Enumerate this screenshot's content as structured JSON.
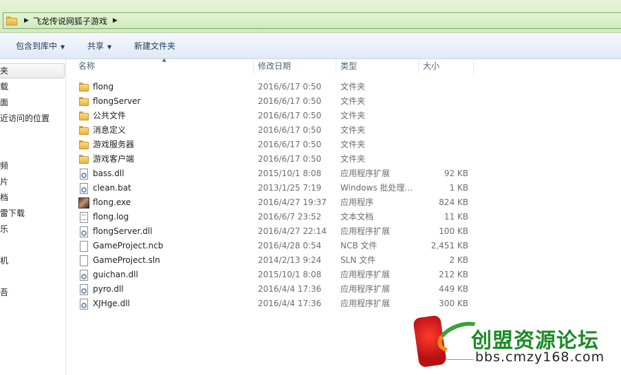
{
  "address_bar": {
    "path": [
      "飞龙传说网狐子游戏"
    ]
  },
  "toolbar": {
    "include_in_library": "包含到库中",
    "share": "共享",
    "new_folder": "新建文件夹"
  },
  "nav": {
    "items": [
      "夹",
      "载",
      "面",
      "近访问的位置",
      "频",
      "片",
      "档",
      "雷下载",
      "乐",
      "机",
      "吾"
    ]
  },
  "columns": {
    "name": "名称",
    "date": "修改日期",
    "type": "类型",
    "size": "大小"
  },
  "files": [
    {
      "name": "flong",
      "date": "2016/6/17 0:50",
      "type": "文件夹",
      "size": "",
      "icon": "folder-icon"
    },
    {
      "name": "flongServer",
      "date": "2016/6/17 0:50",
      "type": "文件夹",
      "size": "",
      "icon": "folder-icon"
    },
    {
      "name": "公共文件",
      "date": "2016/6/17 0:50",
      "type": "文件夹",
      "size": "",
      "icon": "folder-icon"
    },
    {
      "name": "消息定义",
      "date": "2016/6/17 0:50",
      "type": "文件夹",
      "size": "",
      "icon": "folder-icon"
    },
    {
      "name": "游戏服务器",
      "date": "2016/6/17 0:50",
      "type": "文件夹",
      "size": "",
      "icon": "folder-icon"
    },
    {
      "name": "游戏客户端",
      "date": "2016/6/17 0:50",
      "type": "文件夹",
      "size": "",
      "icon": "folder-icon"
    },
    {
      "name": "bass.dll",
      "date": "2015/10/1 8:08",
      "type": "应用程序扩展",
      "size": "92 KB",
      "icon": "dll-icon"
    },
    {
      "name": "clean.bat",
      "date": "2013/1/25 7:19",
      "type": "Windows 批处理...",
      "size": "1 KB",
      "icon": "bat-icon"
    },
    {
      "name": "flong.exe",
      "date": "2016/4/27 19:37",
      "type": "应用程序",
      "size": "824 KB",
      "icon": "exe-icon"
    },
    {
      "name": "flong.log",
      "date": "2016/6/7 23:52",
      "type": "文本文档",
      "size": "11 KB",
      "icon": "text-file-icon"
    },
    {
      "name": "flongServer.dll",
      "date": "2016/4/27 22:14",
      "type": "应用程序扩展",
      "size": "100 KB",
      "icon": "dll-icon"
    },
    {
      "name": "GameProject.ncb",
      "date": "2016/4/28 0:54",
      "type": "NCB 文件",
      "size": "2,451 KB",
      "icon": "file-icon"
    },
    {
      "name": "GameProject.sln",
      "date": "2014/2/13 9:24",
      "type": "SLN 文件",
      "size": "2 KB",
      "icon": "file-icon"
    },
    {
      "name": "guichan.dll",
      "date": "2015/10/1 8:08",
      "type": "应用程序扩展",
      "size": "212 KB",
      "icon": "dll-icon"
    },
    {
      "name": "pyro.dll",
      "date": "2016/4/4 17:36",
      "type": "应用程序扩展",
      "size": "449 KB",
      "icon": "dll-icon"
    },
    {
      "name": "XJHge.dll",
      "date": "2016/4/4 17:36",
      "type": "应用程序扩展",
      "size": "300 KB",
      "icon": "dll-icon"
    }
  ],
  "watermark": {
    "title": "创盟资源论坛",
    "url": "bbs.cmzy168.com"
  }
}
